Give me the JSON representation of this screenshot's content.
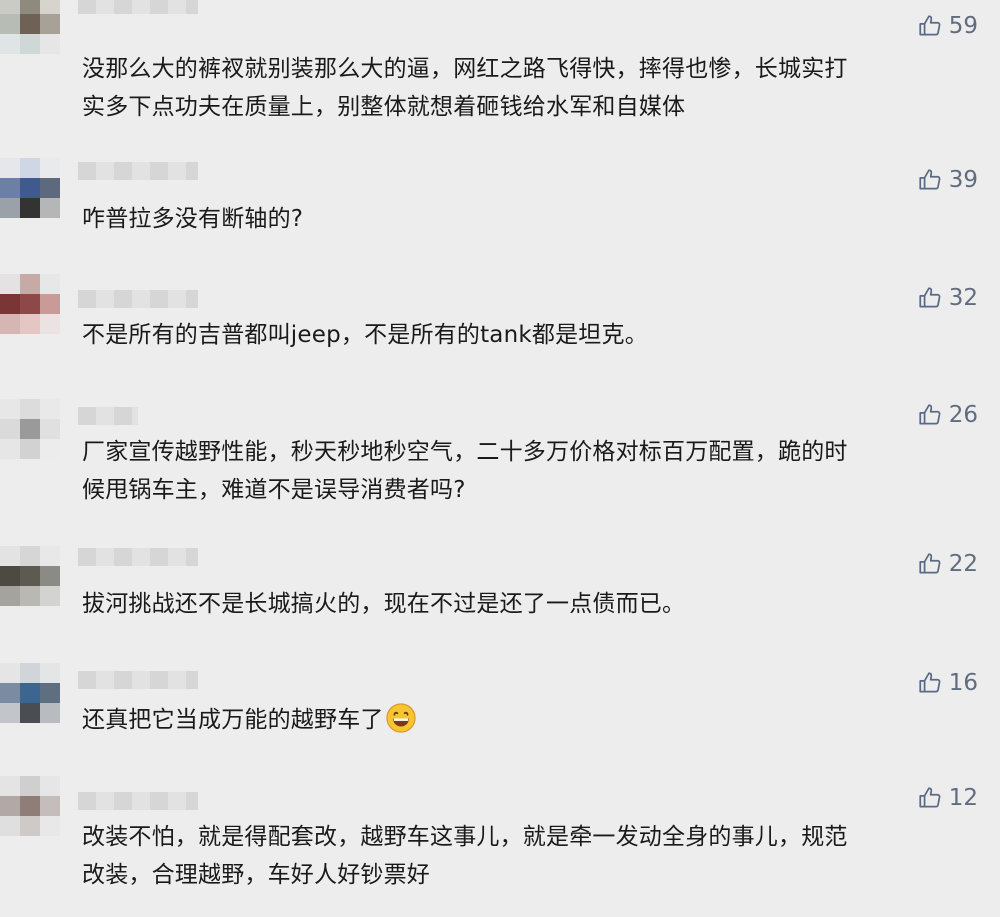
{
  "colors": {
    "background": "#ededed",
    "text": "#1a1a1a",
    "like_count": "#606c80"
  },
  "comments": [
    {
      "text_lines": [
        "没那么大的裤衩就别装那么大的逼，网红之路飞得快，摔得也惨，长城实打",
        "实多下点功夫在质量上，别整体就想着砸钱给水军和自媒体"
      ],
      "likes": "59"
    },
    {
      "text_lines": [
        "咋普拉多没有断轴的?"
      ],
      "likes": "39"
    },
    {
      "text_lines": [
        "不是所有的吉普都叫jeep，不是所有的tank都是坦克。"
      ],
      "likes": "32"
    },
    {
      "text_lines": [
        "厂家宣传越野性能，秒天秒地秒空气，二十多万价格对标百万配置，跪的时",
        "候甩锅车主，难道不是误导消费者吗?"
      ],
      "likes": "26"
    },
    {
      "text_lines": [
        "拔河挑战还不是长城搞火的，现在不过是还了一点债而已。"
      ],
      "likes": "22"
    },
    {
      "text_lines": [
        "还真把它当成万能的越野车了"
      ],
      "likes": "16",
      "emoji": "grinning-face-emoji"
    },
    {
      "text_lines": [
        "改装不怕，就是得配套改，越野车这事儿，就是牵一发动全身的事儿，规范",
        "改装，合理越野，车好人好钞票好"
      ],
      "likes": "12"
    }
  ],
  "icons": {
    "like": "thumbs-up-outline-icon"
  }
}
